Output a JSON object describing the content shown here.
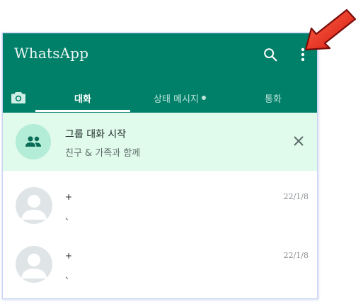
{
  "app": {
    "title": "WhatsApp"
  },
  "header": {
    "search_icon": "search-icon",
    "menu_icon": "more-vert-icon"
  },
  "tabs": [
    {
      "id": "camera",
      "icon": "camera-icon"
    },
    {
      "id": "chats",
      "label": "대화",
      "selected": true
    },
    {
      "id": "status",
      "label": "상태 메시지"
    },
    {
      "id": "calls",
      "label": "통화"
    }
  ],
  "banner": {
    "icon": "group-icon",
    "title": "그룹 대화 시작",
    "subtitle": "친구 & 가족과 함께",
    "close_icon": "close-icon"
  },
  "chats": [
    {
      "name": "+",
      "message": "、",
      "time": "22/1/8",
      "avatar": "default-avatar-icon"
    },
    {
      "name": "+",
      "message": "、",
      "time": "22/1/8",
      "avatar": "default-avatar-icon"
    }
  ],
  "colors": {
    "header": "#008069",
    "banner": "#e0fbeb",
    "annotation_arrow": "#e8201a"
  }
}
